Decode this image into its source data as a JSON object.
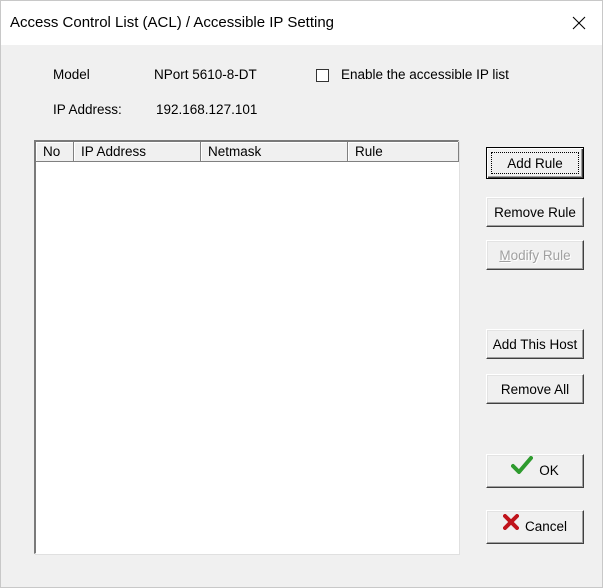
{
  "window": {
    "title": "Access Control List (ACL) / Accessible IP Setting"
  },
  "info": {
    "model_label": "Model",
    "model_value": "NPort 5610-8-DT",
    "ip_label": "IP Address:",
    "ip_value": "192.168.127.101"
  },
  "options": {
    "enable_accessible_ip_label": "Enable the accessible IP list",
    "enable_accessible_ip_checked": false
  },
  "table": {
    "columns": [
      "No",
      "IP Address",
      "Netmask",
      "Rule"
    ],
    "rows": []
  },
  "buttons": {
    "add_rule": "Add Rule",
    "remove_rule": "Remove Rule",
    "modify_rule_prefix": "M",
    "modify_rule_rest": "odify Rule",
    "add_this_host": "Add This Host",
    "remove_all": "Remove All",
    "ok": "OK",
    "cancel": "Cancel"
  },
  "icons": {
    "close": "close-icon",
    "ok": "green-check-icon",
    "cancel": "red-x-icon"
  },
  "colors": {
    "ok_check": "#2e9b2e",
    "cancel_x": "#c0141c",
    "disabled_text": "#a0a0a0"
  }
}
